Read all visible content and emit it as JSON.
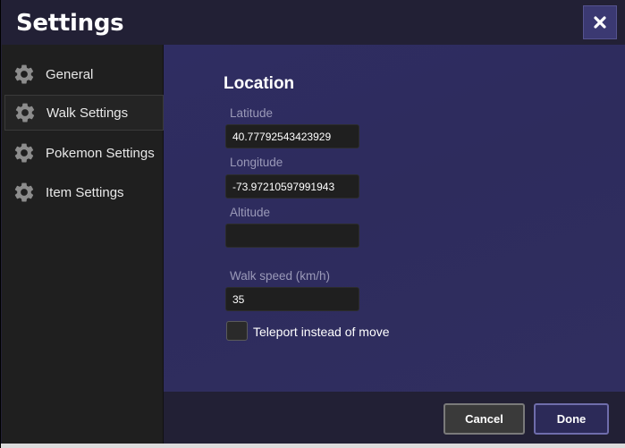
{
  "window": {
    "title": "Settings"
  },
  "sidebar": {
    "items": [
      {
        "label": "General",
        "icon": "gear-icon",
        "active": false
      },
      {
        "label": "Walk Settings",
        "icon": "gear-icon",
        "active": true
      },
      {
        "label": "Pokemon Settings",
        "icon": "gear-icon",
        "active": false
      },
      {
        "label": "Item Settings",
        "icon": "gear-icon",
        "active": false
      }
    ]
  },
  "main": {
    "section_title": "Location",
    "latitude": {
      "label": "Latitude",
      "value": "40.77792543423929"
    },
    "longitude": {
      "label": "Longitude",
      "value": "-73.97210597991943"
    },
    "altitude": {
      "label": "Altitude",
      "value": ""
    },
    "walk_speed": {
      "label": "Walk speed (km/h)",
      "value": "35"
    },
    "teleport": {
      "label": "Teleport instead of move",
      "checked": false
    }
  },
  "footer": {
    "cancel_label": "Cancel",
    "done_label": "Done"
  },
  "colors": {
    "accent": "#3b3972",
    "content_bg": "#2f2d62",
    "sidebar_bg": "#1f1f1f",
    "titlebar_bg": "#222035"
  }
}
